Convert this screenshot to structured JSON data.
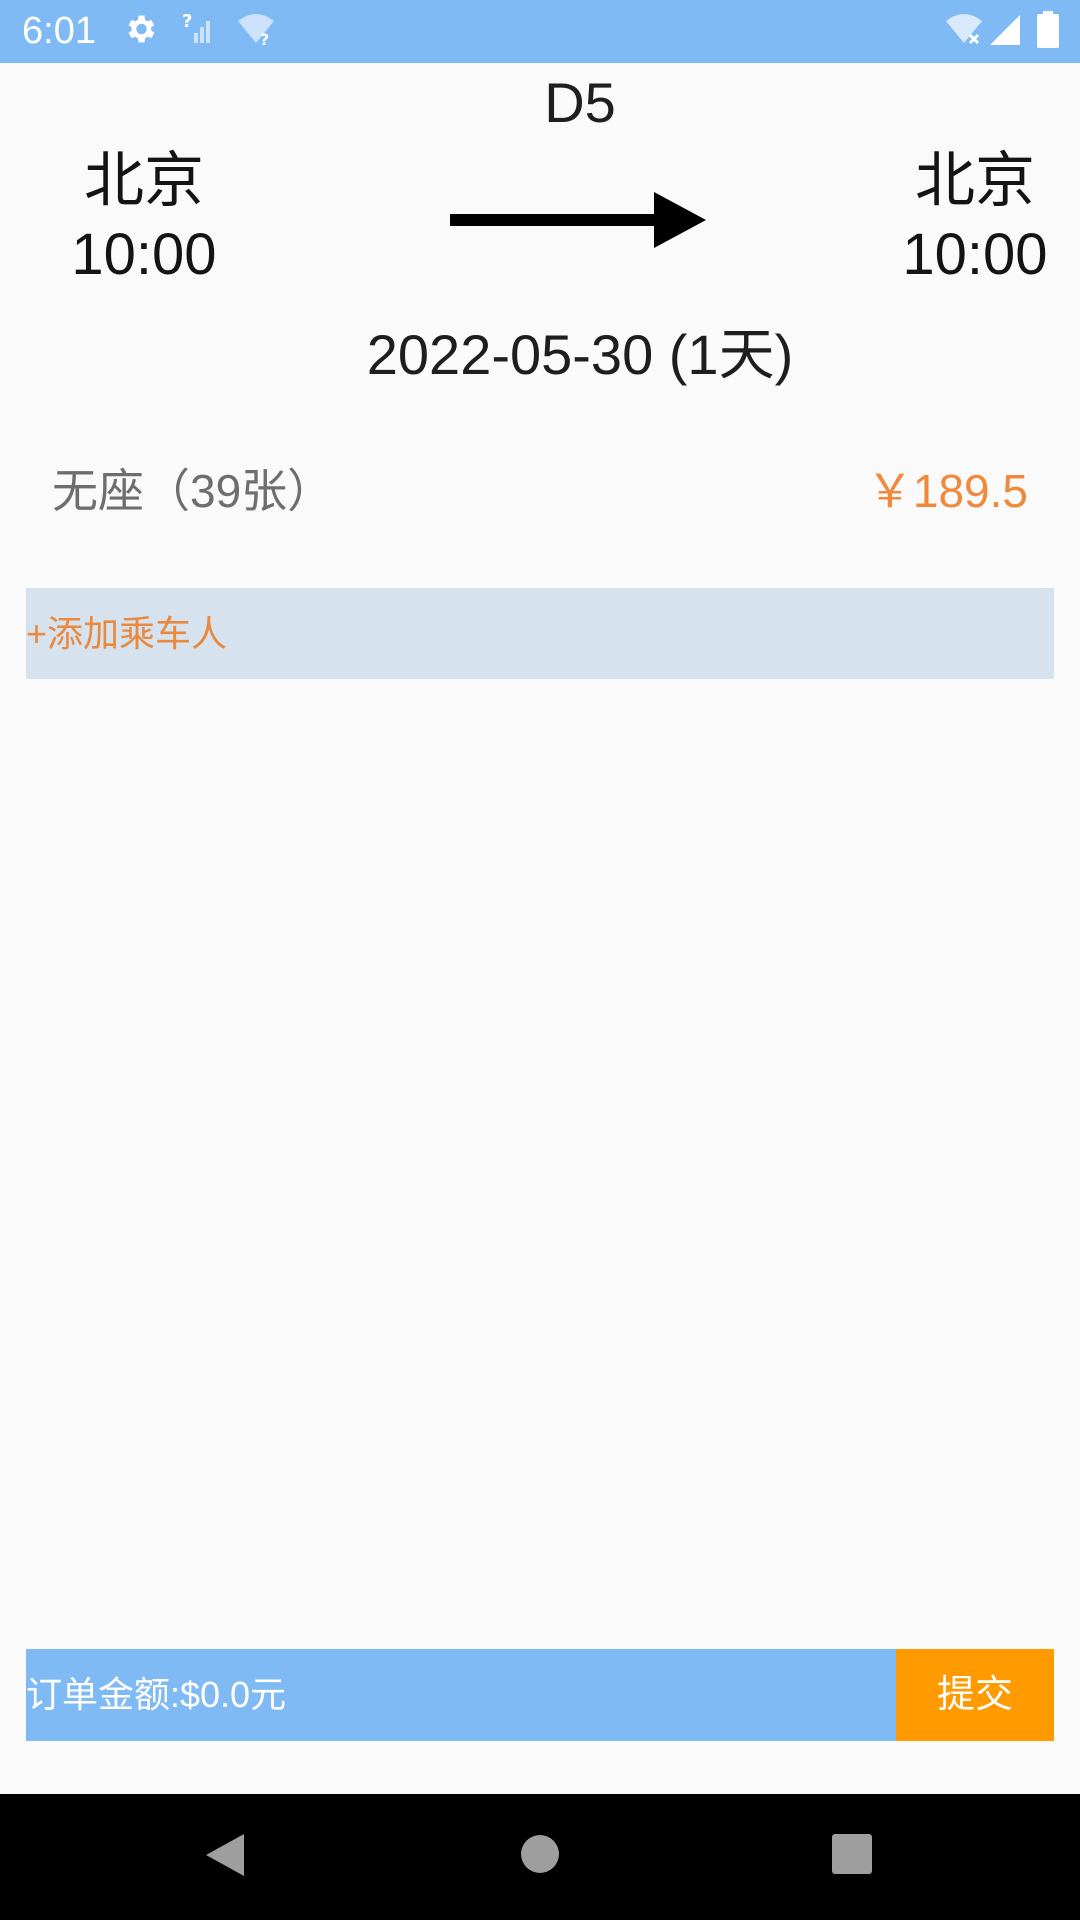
{
  "status_bar": {
    "time": "6:01",
    "background": "#7fbaf5",
    "icons": [
      "gear-icon",
      "no-signal-icon",
      "wifi-unknown-icon",
      "wifi-off-icon",
      "cell-signal-icon",
      "battery-icon"
    ]
  },
  "train": {
    "number": "D5",
    "from_city": "北京",
    "from_time": "10:00",
    "to_city": "北京",
    "to_time": "10:00",
    "date": "2022-05-30 (1天)"
  },
  "seat": {
    "type": "无座（39张）",
    "price": "￥189.5",
    "price_color": "#f0893c"
  },
  "add_passenger_label": "+添加乘车人",
  "order": {
    "amount_label": "订单金额:$0.0元",
    "submit_label": "提交",
    "bar_color": "#7fbaf5",
    "submit_color": "#ff9b00"
  },
  "nav_bar": {
    "icons": [
      "back-icon",
      "home-icon",
      "recents-icon"
    ]
  }
}
